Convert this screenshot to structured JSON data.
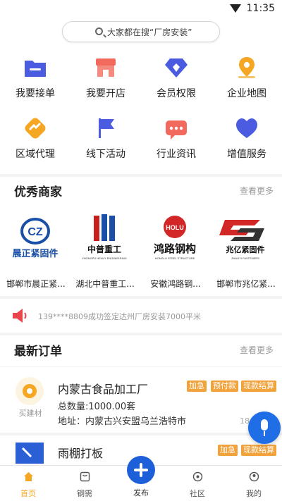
{
  "status": {
    "time": "11:35"
  },
  "search": {
    "placeholder": "大家都在搜“厂房安装”"
  },
  "grid": [
    {
      "label": "我要接单",
      "icon": "folder-icon",
      "color": "#4b5ce0"
    },
    {
      "label": "我要开店",
      "icon": "store-icon",
      "color": "#f26a5e"
    },
    {
      "label": "会员权限",
      "icon": "diamond-icon",
      "color": "#4a5be0"
    },
    {
      "label": "企业地图",
      "icon": "map-pin-icon",
      "color": "#f5a623"
    },
    {
      "label": "区域代理",
      "icon": "handshake-icon",
      "color": "#f5a623"
    },
    {
      "label": "线下活动",
      "icon": "flag-icon",
      "color": "#4b5ce0"
    },
    {
      "label": "行业资讯",
      "icon": "chat-icon",
      "color": "#f26a5e"
    },
    {
      "label": "增值服务",
      "icon": "heart-icon",
      "color": "#4b5ce0"
    }
  ],
  "merchants_section": {
    "title": "优秀商家",
    "more": "查看更多"
  },
  "merchants": [
    {
      "name": "邯郸市晨正紧...",
      "logo_text": "晨正紧固件",
      "logo_mark": "CZ"
    },
    {
      "name": "湖北中普重工...",
      "logo_text": "中普重工",
      "logo_sub": "ZHONGPU HEAVY ENGINEERING"
    },
    {
      "name": "安徽鸿路钢...",
      "logo_text": "鸿路钢构",
      "logo_sub": "HONGLU STEEL STRUCTURE",
      "logo_mark": "HOLU"
    },
    {
      "name": "邯郸市兆亿紧...",
      "logo_text": "兆亿紧固件",
      "logo_sub": "ZHAOYI FASTENERS"
    }
  ],
  "notice": {
    "text": "139****8809成功签定达州厂房安装7000平米"
  },
  "orders_section": {
    "title": "最新订单",
    "more": "查看更多"
  },
  "orders": [
    {
      "title": "内蒙古食品加工厂",
      "category": "买建材",
      "quantity": "总数量:1000.00套",
      "address": "地址：内蒙古兴安盟乌兰浩特市",
      "tags": [
        "加急",
        "预付款",
        "现款结算"
      ],
      "side": "18"
    },
    {
      "title": "雨棚打板",
      "tags": [
        "加急",
        "现款结算"
      ]
    }
  ],
  "tabs": [
    {
      "label": "首页",
      "icon": "home-icon",
      "active": true
    },
    {
      "label": "钢需",
      "icon": "bag-icon"
    },
    {
      "label": "发布",
      "icon": "plus-icon"
    },
    {
      "label": "社区",
      "icon": "community-icon"
    },
    {
      "label": "我的",
      "icon": "profile-icon"
    }
  ],
  "colors": {
    "accent": "#1f6ee6",
    "tag": "#f2a23a",
    "home_active": "#f5a623"
  }
}
